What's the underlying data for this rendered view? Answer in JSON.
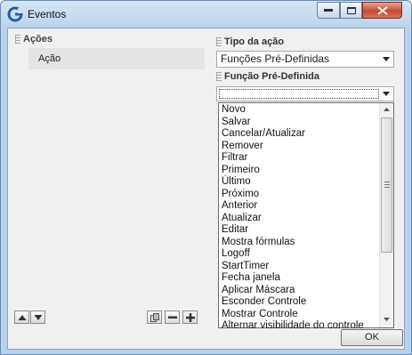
{
  "window": {
    "title": "Eventos",
    "icons": {
      "app": "app-logo-icon",
      "minimize": "minimize-icon",
      "maximize": "maximize-icon",
      "close": "close-icon"
    }
  },
  "left": {
    "section_title": "Ações",
    "items": [
      "Ação"
    ],
    "tools": {
      "up": "arrow-up-icon",
      "down": "arrow-down-icon",
      "copy": "copy-icon",
      "remove": "minus-icon",
      "add": "plus-icon"
    }
  },
  "right": {
    "tipo_label": "Tipo da ação",
    "tipo_value": "Funções Pré-Definidas",
    "funcao_label": "Função Pré-Definida",
    "funcao_value": ""
  },
  "dropdown": {
    "options": [
      "Novo",
      "Salvar",
      "Cancelar/Atualizar",
      "Remover",
      "Filtrar",
      "Primeiro",
      "Último",
      "Próximo",
      "Anterior",
      "Atualizar",
      "Editar",
      "Mostra fórmulas",
      "Logoff",
      "StartTimer",
      "Fecha janela",
      "Aplicar Máscara",
      "Esconder Controle",
      "Mostrar Controle",
      "Alternar visibilidade do controle"
    ]
  },
  "footer": {
    "ok_label": "OK"
  }
}
